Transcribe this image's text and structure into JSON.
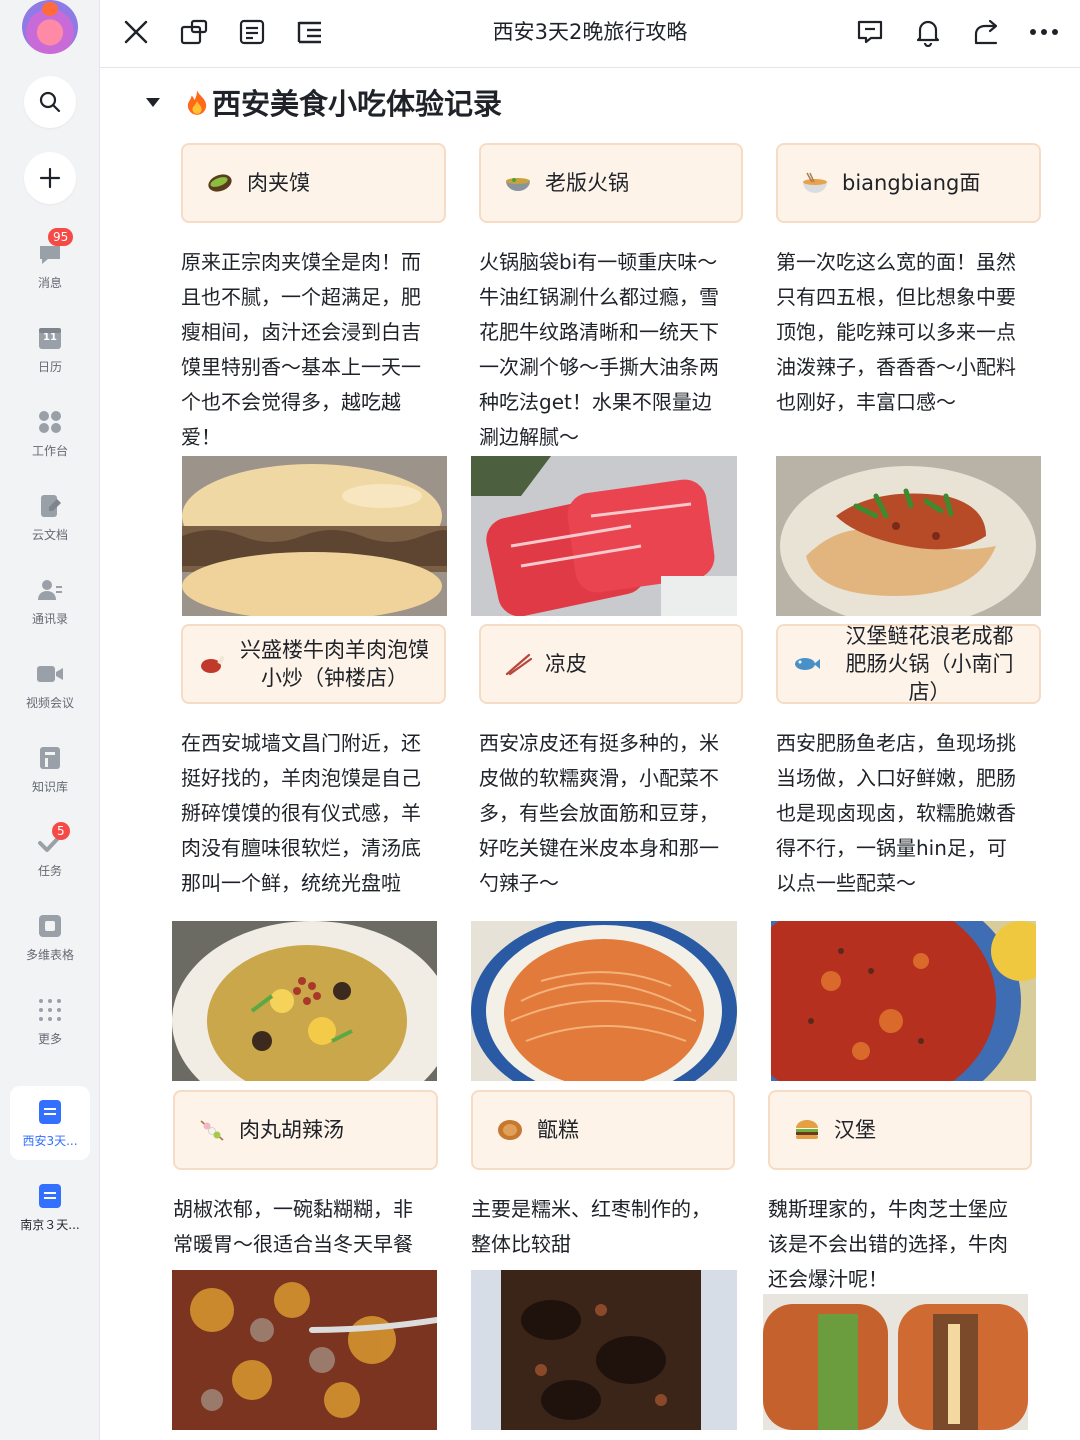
{
  "sidebar": {
    "items": [
      {
        "label": "消息",
        "icon": "chat-bubble-icon",
        "badge": "95"
      },
      {
        "label": "日历",
        "icon": "calendar-icon",
        "day": "11"
      },
      {
        "label": "工作台",
        "icon": "apps-grid-icon"
      },
      {
        "label": "云文档",
        "icon": "cloud-doc-icon"
      },
      {
        "label": "通讯录",
        "icon": "contacts-icon"
      },
      {
        "label": "视频会议",
        "icon": "video-camera-icon"
      },
      {
        "label": "知识库",
        "icon": "knowledge-base-icon"
      },
      {
        "label": "任务",
        "icon": "task-check-icon",
        "badge": "5"
      },
      {
        "label": "多维表格",
        "icon": "base-table-icon"
      },
      {
        "label": "更多",
        "icon": "more-dots-grid-icon"
      }
    ],
    "docs": [
      {
        "label": "西安3天...",
        "active": true
      },
      {
        "label": "南京３天...",
        "active": false
      }
    ]
  },
  "topbar": {
    "title": "西安3天2晚旅行攻略"
  },
  "section": {
    "heading": "西安美食小吃体验记录"
  },
  "cards": [
    {
      "title": "肉夹馍",
      "emoji": "burrito",
      "desc": [
        "原来正宗肉夹馍全是肉！而",
        "且也不腻，一个超满足，肥",
        "瘦相间，卤汁还会浸到白吉",
        "馍里特别香～基本上一天一",
        "个也不会觉得多，越吃越",
        "爱！"
      ],
      "photo": "roujiamo"
    },
    {
      "title": "老版火锅",
      "emoji": "bowl",
      "desc": [
        "火锅脑袋bi有一顿重庆味～",
        "牛油红锅涮什么都过瘾，雪",
        "花肥牛纹路清晰和一统天下",
        "一次涮个够～手撕大油条两",
        "种吃法get！水果不限量边",
        "涮边解腻～"
      ],
      "photo": "beef"
    },
    {
      "title": "biangbiang面",
      "emoji": "noodles",
      "desc": [
        "第一次吃这么宽的面！虽然",
        "只有四五根，但比想象中要",
        "顶饱，能吃辣可以多来一点",
        "油泼辣子，香香香～小配料",
        "也刚好，丰富口感～"
      ],
      "photo": "biang"
    },
    {
      "title": "兴盛楼牛肉羊肉泡馍小炒（钟楼店）",
      "title_lines": [
        "兴盛楼牛肉羊肉泡馍",
        "小炒（钟楼店）"
      ],
      "emoji": "meat",
      "desc": [
        "在西安城墙文昌门附近，还",
        "挺好找的，羊肉泡馍是自己",
        "掰碎馍馍的很有仪式感，羊",
        "肉没有膻味很软烂，清汤底",
        "那叫一个鲜，统统光盘啦"
      ],
      "photo": "paomo"
    },
    {
      "title": "凉皮",
      "emoji": "chopsticks",
      "desc": [
        "西安凉皮还有挺多种的，米",
        "皮做的软糯爽滑，小配菜不",
        "多，有些会放面筋和豆芽，",
        "好吃关键在米皮本身和那一",
        "勺辣子～"
      ],
      "photo": "liangpi"
    },
    {
      "title": "汉堡鲢花浪老成都肥肠火锅（小南门店）",
      "title_lines": [
        "汉堡鲢花浪老成都",
        "肥肠火锅（小南门店）"
      ],
      "emoji": "fish",
      "desc": [
        "西安肥肠鱼老店，鱼现场挑",
        "当场做，入口好鲜嫩，肥肠",
        "也是现卤现卤，软糯脆嫩香",
        "得不行，一锅量hin足，可",
        "以点一些配菜～"
      ],
      "photo": "fishpot"
    },
    {
      "title": "肉丸胡辣汤",
      "emoji": "skewer",
      "desc": [
        "胡椒浓郁，一碗黏糊糊，非",
        "常暖胃～很适合当冬天早餐"
      ],
      "photo": "hulatang"
    },
    {
      "title": "甑糕",
      "emoji": "mooncake",
      "desc": [
        "主要是糯米、红枣制作的，",
        "整体比较甜"
      ],
      "photo": "zenggao"
    },
    {
      "title": "汉堡",
      "emoji": "burger",
      "desc": [
        "魏斯理家的，牛肉芝士堡应",
        "该是不会出错的选择，牛肉",
        "还会爆汁呢！"
      ],
      "photo": "burger"
    }
  ]
}
